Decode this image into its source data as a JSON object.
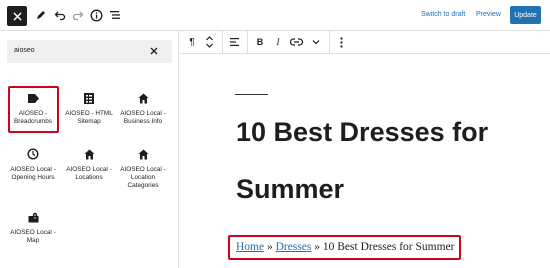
{
  "topbar": {
    "switch_to_draft": "Switch to draft",
    "preview": "Preview",
    "update": "Update"
  },
  "search": {
    "value": "aioseo"
  },
  "blocks": [
    {
      "label": "AIOSEO - Breadcrumbs",
      "icon": "breadcrumbs-icon",
      "highlighted": true
    },
    {
      "label": "AIOSEO - HTML Sitemap",
      "icon": "sitemap-icon"
    },
    {
      "label": "AIOSEO Local - Business Info",
      "icon": "home-icon"
    },
    {
      "label": "AIOSEO Local - Opening Hours",
      "icon": "clock-icon"
    },
    {
      "label": "AIOSEO Local - Locations",
      "icon": "home-icon"
    },
    {
      "label": "AIOSEO Local - Location Categories",
      "icon": "home-icon"
    },
    {
      "label": "AIOSEO Local - Map",
      "icon": "map-icon"
    }
  ],
  "post": {
    "title_line1": "10 Best Dresses for",
    "title_line2": "Summer",
    "breadcrumb": {
      "home": "Home",
      "sep1": " » ",
      "category": "Dresses",
      "sep2": " » ",
      "current": "10 Best Dresses for Summer"
    }
  },
  "colors": {
    "accent": "#2271b1",
    "highlight": "#d0021b",
    "dark": "#1e1e1e"
  }
}
